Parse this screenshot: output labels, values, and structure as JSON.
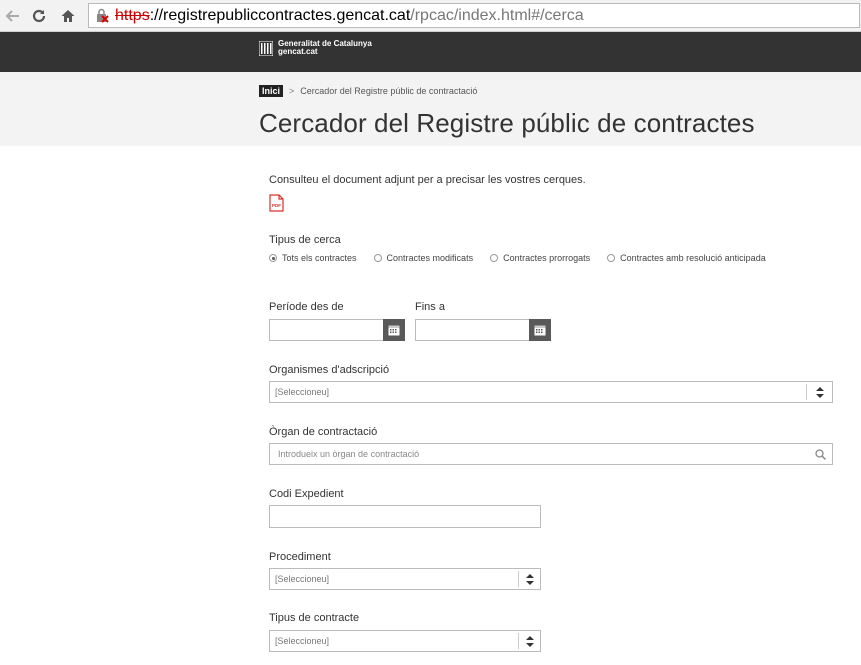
{
  "browser": {
    "url_scheme": "https",
    "url_host": "://registrepubliccontractes.gencat.cat",
    "url_path": "/rpcac/index.html#/cerca"
  },
  "header": {
    "logo_line1": "Generalitat de Catalunya",
    "logo_line2": "gencat.cat"
  },
  "breadcrumb": {
    "home": "Inici",
    "separator": ">",
    "current": "Cercador del Registre públic de contractació"
  },
  "page": {
    "title": "Cercador del Registre públic de contractes"
  },
  "form": {
    "intro": "Consulteu el document adjunt per a precisar les vostres cerques.",
    "pdf_label": "PDF",
    "search_type_label": "Tipus de cerca",
    "search_types": [
      {
        "label": "Tots els contractes",
        "selected": true
      },
      {
        "label": "Contractes modificats",
        "selected": false
      },
      {
        "label": "Contractes prorrogats",
        "selected": false
      },
      {
        "label": "Contractes amb resolució anticipada",
        "selected": false
      }
    ],
    "period_from_label": "Període des de",
    "period_to_label": "Fins a",
    "organisms_label": "Organismes d'adscripció",
    "organisms_value": "[Seleccioneu]",
    "organ_label": "Òrgan de contractació",
    "organ_placeholder": "Introdueix un òrgan de contractació",
    "file_code_label": "Codi Expedient",
    "procedure_label": "Procediment",
    "procedure_value": "[Seleccioneu]",
    "contract_type_label": "Tipus de contracte",
    "contract_type_value": "[Seleccioneu]"
  },
  "colors": {
    "topbar": "#333333",
    "titlebar": "#f3f3f3",
    "date_button": "#595959",
    "pdf_red": "#d9302c"
  }
}
